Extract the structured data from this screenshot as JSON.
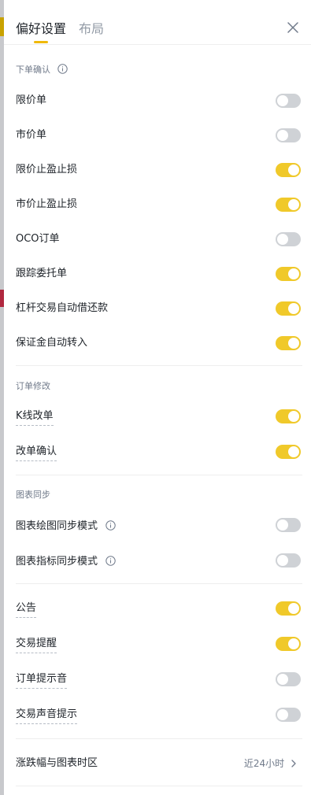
{
  "tabs": [
    {
      "label": "偏好设置",
      "active": true
    },
    {
      "label": "布局",
      "active": false
    }
  ],
  "sections": [
    {
      "title": "下单确认",
      "items": [
        {
          "label": "限价单",
          "on": false
        },
        {
          "label": "市价单",
          "on": false
        },
        {
          "label": "限价止盈止损",
          "on": true
        },
        {
          "label": "市价止盈止损",
          "on": true
        },
        {
          "label": "OCO订单",
          "on": false
        },
        {
          "label": "跟踪委托单",
          "on": true
        },
        {
          "label": "杠杆交易自动借还款",
          "on": true
        },
        {
          "label": "保证金自动转入",
          "on": true
        }
      ]
    },
    {
      "title": "订单修改",
      "items": [
        {
          "label": "K线改单",
          "on": true
        },
        {
          "label": "改单确认",
          "on": true
        }
      ]
    },
    {
      "title": "图表同步",
      "items": [
        {
          "label": "图表绘图同步模式",
          "on": false
        },
        {
          "label": "图表指标同步模式",
          "on": false
        }
      ]
    },
    {
      "title": "",
      "items": [
        {
          "label": "公告",
          "on": true
        },
        {
          "label": "交易提醒",
          "on": true
        },
        {
          "label": "订单提示音",
          "on": false
        },
        {
          "label": "交易声音提示",
          "on": false
        }
      ]
    }
  ],
  "timezone": {
    "label": "涨跌幅与图表时区",
    "value": "近24小时"
  },
  "colors": {
    "accent": "#f0b90b",
    "toggle_on": "#f0c92a",
    "toggle_off": "#cfd2d6"
  }
}
